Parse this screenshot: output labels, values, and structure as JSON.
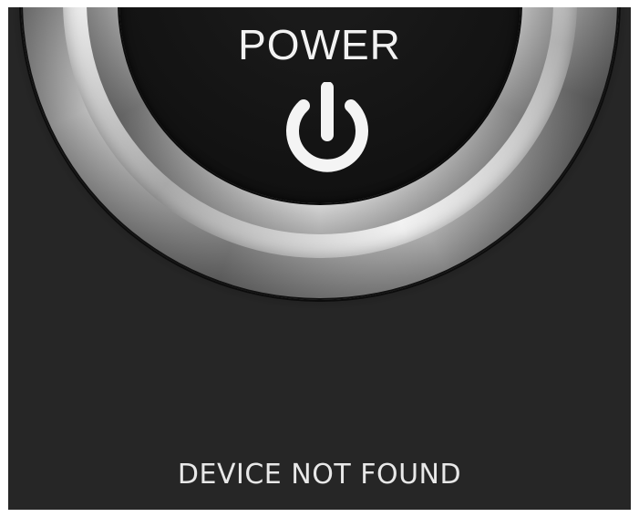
{
  "power_button": {
    "label": "POWER",
    "icon": "power-icon"
  },
  "status": {
    "text": "DEVICE NOT FOUND"
  },
  "colors": {
    "background": "#262626",
    "button_face": "#141414",
    "text": "#f2f2f2"
  }
}
